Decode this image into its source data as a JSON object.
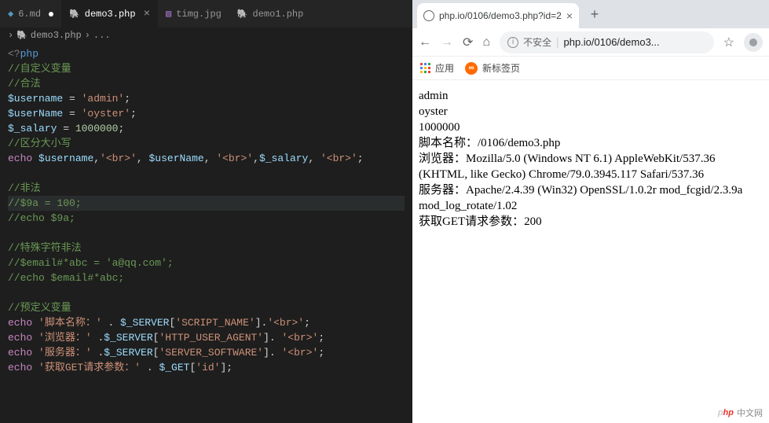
{
  "editor": {
    "tabs": [
      {
        "icon": "md",
        "label": "6.md",
        "modified": true,
        "active": false
      },
      {
        "icon": "php",
        "label": "demo3.php",
        "modified": false,
        "active": true,
        "closable": true
      },
      {
        "icon": "img",
        "label": "timg.jpg",
        "modified": false,
        "active": false
      },
      {
        "icon": "php",
        "label": "demo1.php",
        "modified": false,
        "active": false
      }
    ],
    "breadcrumb": {
      "file_icon": "php",
      "file": "demo3.php",
      "section": "..."
    },
    "code_lines": [
      {
        "tokens": [
          {
            "cls": "tag",
            "t": "<?"
          },
          {
            "cls": "php-open",
            "t": "php"
          }
        ]
      },
      {
        "tokens": [
          {
            "cls": "comment",
            "t": "//自定义变量"
          }
        ]
      },
      {
        "tokens": [
          {
            "cls": "comment",
            "t": "//合法"
          }
        ]
      },
      {
        "tokens": [
          {
            "cls": "var",
            "t": "$username"
          },
          {
            "cls": "op",
            "t": " = "
          },
          {
            "cls": "str",
            "t": "'admin'"
          },
          {
            "cls": "punc",
            "t": ";"
          }
        ]
      },
      {
        "tokens": [
          {
            "cls": "var",
            "t": "$userName"
          },
          {
            "cls": "op",
            "t": " = "
          },
          {
            "cls": "str",
            "t": "'oyster'"
          },
          {
            "cls": "punc",
            "t": ";"
          }
        ]
      },
      {
        "tokens": [
          {
            "cls": "var",
            "t": "$_salary"
          },
          {
            "cls": "op",
            "t": " = "
          },
          {
            "cls": "num",
            "t": "1000000"
          },
          {
            "cls": "punc",
            "t": ";"
          }
        ]
      },
      {
        "tokens": [
          {
            "cls": "comment",
            "t": "//区分大小写"
          }
        ]
      },
      {
        "tokens": [
          {
            "cls": "kw",
            "t": "echo"
          },
          {
            "cls": "op",
            "t": " "
          },
          {
            "cls": "var",
            "t": "$username"
          },
          {
            "cls": "punc",
            "t": ","
          },
          {
            "cls": "str",
            "t": "'<br>'"
          },
          {
            "cls": "punc",
            "t": ", "
          },
          {
            "cls": "var",
            "t": "$userName"
          },
          {
            "cls": "punc",
            "t": ", "
          },
          {
            "cls": "str",
            "t": "'<br>'"
          },
          {
            "cls": "punc",
            "t": ","
          },
          {
            "cls": "var",
            "t": "$_salary"
          },
          {
            "cls": "punc",
            "t": ", "
          },
          {
            "cls": "str",
            "t": "'<br>'"
          },
          {
            "cls": "punc",
            "t": ";"
          }
        ]
      },
      {
        "tokens": []
      },
      {
        "tokens": [
          {
            "cls": "comment",
            "t": "//非法"
          }
        ]
      },
      {
        "highlight": true,
        "tokens": [
          {
            "cls": "comment",
            "t": "//$9a = 100;"
          }
        ]
      },
      {
        "tokens": [
          {
            "cls": "comment",
            "t": "//echo $9a;"
          }
        ]
      },
      {
        "tokens": []
      },
      {
        "tokens": [
          {
            "cls": "comment",
            "t": "//特殊字符非法"
          }
        ]
      },
      {
        "tokens": [
          {
            "cls": "comment",
            "t": "//$email#*abc = 'a@qq.com';"
          }
        ]
      },
      {
        "tokens": [
          {
            "cls": "comment",
            "t": "//echo $email#*abc;"
          }
        ]
      },
      {
        "tokens": []
      },
      {
        "tokens": [
          {
            "cls": "comment",
            "t": "//预定义变量"
          }
        ]
      },
      {
        "tokens": [
          {
            "cls": "kw",
            "t": "echo"
          },
          {
            "cls": "op",
            "t": " "
          },
          {
            "cls": "str",
            "t": "'脚本名称：'"
          },
          {
            "cls": "op",
            "t": " . "
          },
          {
            "cls": "var",
            "t": "$_SERVER"
          },
          {
            "cls": "punc",
            "t": "["
          },
          {
            "cls": "str",
            "t": "'SCRIPT_NAME'"
          },
          {
            "cls": "punc",
            "t": "]."
          },
          {
            "cls": "str",
            "t": "'<br>'"
          },
          {
            "cls": "punc",
            "t": ";"
          }
        ]
      },
      {
        "tokens": [
          {
            "cls": "kw",
            "t": "echo"
          },
          {
            "cls": "op",
            "t": " "
          },
          {
            "cls": "str",
            "t": "'浏览器：'"
          },
          {
            "cls": "op",
            "t": " ."
          },
          {
            "cls": "var",
            "t": "$_SERVER"
          },
          {
            "cls": "punc",
            "t": "["
          },
          {
            "cls": "str",
            "t": "'HTTP_USER_AGENT'"
          },
          {
            "cls": "punc",
            "t": "]. "
          },
          {
            "cls": "str",
            "t": "'<br>'"
          },
          {
            "cls": "punc",
            "t": ";"
          }
        ]
      },
      {
        "tokens": [
          {
            "cls": "kw",
            "t": "echo"
          },
          {
            "cls": "op",
            "t": " "
          },
          {
            "cls": "str",
            "t": "'服务器：'"
          },
          {
            "cls": "op",
            "t": " ."
          },
          {
            "cls": "var",
            "t": "$_SERVER"
          },
          {
            "cls": "punc",
            "t": "["
          },
          {
            "cls": "str",
            "t": "'SERVER_SOFTWARE'"
          },
          {
            "cls": "punc",
            "t": "]. "
          },
          {
            "cls": "str",
            "t": "'<br>'"
          },
          {
            "cls": "punc",
            "t": ";"
          }
        ]
      },
      {
        "tokens": [
          {
            "cls": "kw",
            "t": "echo"
          },
          {
            "cls": "op",
            "t": " "
          },
          {
            "cls": "str",
            "t": "'获取GET请求参数：'"
          },
          {
            "cls": "op",
            "t": " . "
          },
          {
            "cls": "var",
            "t": "$_GET"
          },
          {
            "cls": "punc",
            "t": "["
          },
          {
            "cls": "str",
            "t": "'id'"
          },
          {
            "cls": "punc",
            "t": "];"
          }
        ]
      }
    ]
  },
  "browser": {
    "tab_title": "php.io/0106/demo3.php?id=2",
    "address": {
      "insecure_label": "不安全",
      "url": "php.io/0106/demo3..."
    },
    "bookmarks": {
      "apps_label": "应用",
      "newtab_label": "新标签页"
    },
    "page_output": [
      "admin",
      "oyster",
      "1000000",
      "脚本名称：/0106/demo3.php",
      "浏览器：Mozilla/5.0 (Windows NT 6.1) AppleWebKit/537.36 (KHTML, like Gecko) Chrome/79.0.3945.117 Safari/537.36",
      "服务器：Apache/2.4.39 (Win32) OpenSSL/1.0.2r mod_fcgid/2.3.9a mod_log_rotate/1.02",
      "获取GET请求参数：200"
    ],
    "watermark": "中文网"
  }
}
